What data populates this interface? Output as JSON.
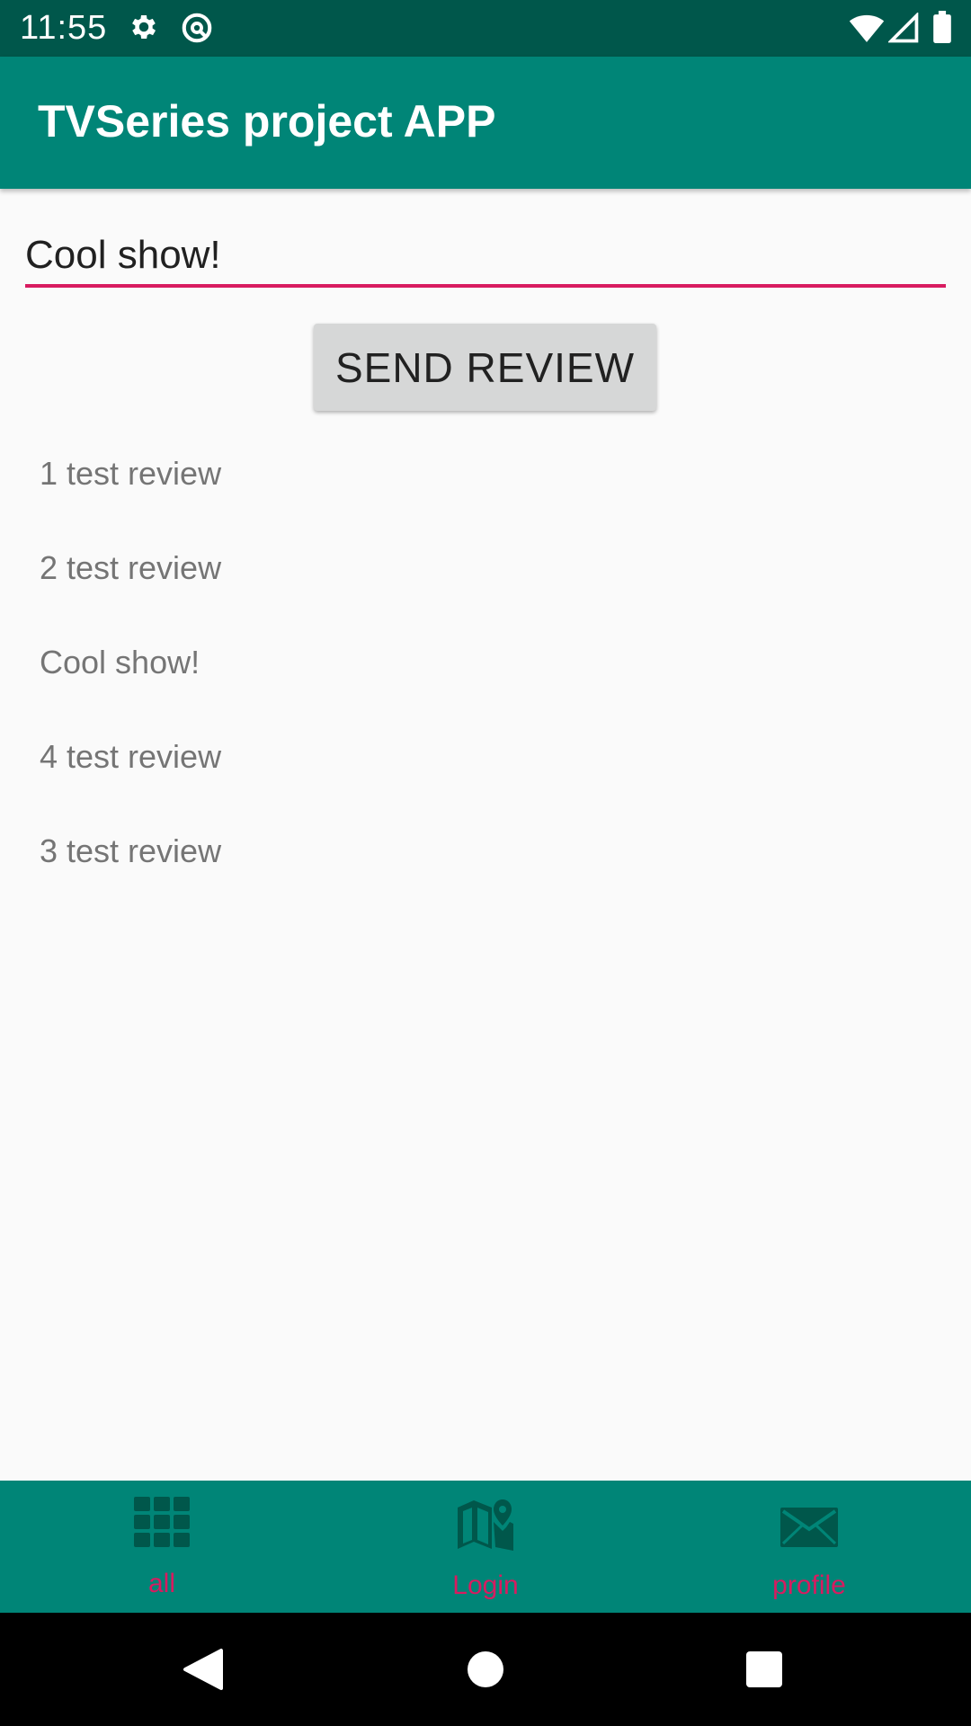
{
  "status_bar": {
    "time": "11:55",
    "icons": [
      "gear-icon",
      "sync-icon",
      "wifi-icon",
      "signal-icon",
      "battery-icon"
    ]
  },
  "app_bar": {
    "title": "TVSeries project APP"
  },
  "review_form": {
    "input_value": "Cool show!",
    "send_label": "SEND REVIEW"
  },
  "reviews": [
    "1 test review",
    "2 test review",
    "Cool show!",
    "4 test review",
    "3 test review"
  ],
  "bottom_nav": [
    {
      "label": "all",
      "icon": "grid-icon"
    },
    {
      "label": "Login",
      "icon": "map-icon"
    },
    {
      "label": "profile",
      "icon": "mail-icon"
    }
  ],
  "system_nav": {
    "icons": [
      "back-icon",
      "home-icon",
      "recents-icon"
    ]
  },
  "colors": {
    "status_bar": "#00574b",
    "primary": "#008577",
    "accent": "#d81b60",
    "background": "#fafafa",
    "button": "#d6d7d7",
    "list_text": "#757575",
    "nav_icon": "#00574b"
  }
}
